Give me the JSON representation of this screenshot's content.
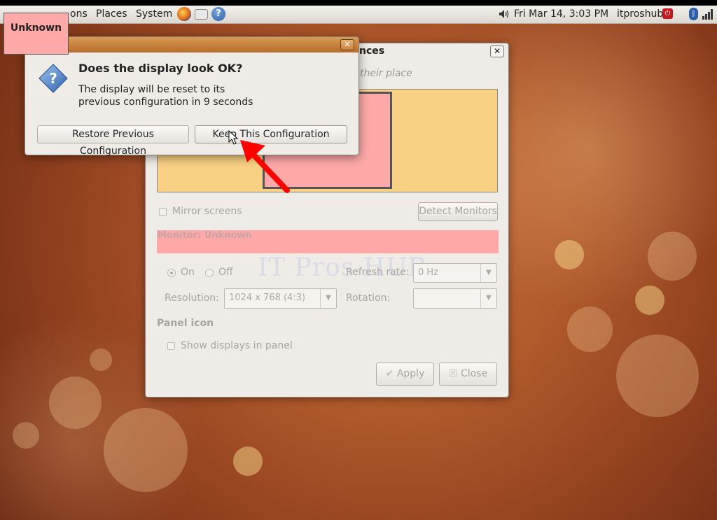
{
  "top_panel": {
    "menus": [
      "ons",
      "Places",
      "System"
    ],
    "clock": "Fri Mar 14,  3:03 PM",
    "user": "itproshub",
    "help_glyph": "?"
  },
  "unknown_label": "Unknown",
  "prefs_window": {
    "title": "nces",
    "hint": "their place",
    "mirror_label": "Mirror screens",
    "detect_button": "Detect Monitors",
    "monitor_heading": "Monitor: Unknown",
    "on_label": "On",
    "off_label": "Off",
    "refresh_label": "Refresh rate:",
    "refresh_value": "0 Hz",
    "resolution_label": "Resolution:",
    "resolution_value": "1024 x 768 (4:3)",
    "rotation_label": "Rotation:",
    "rotation_value": "",
    "panel_icon_heading": "Panel icon",
    "show_displays_label": "Show displays in panel",
    "apply_button": "Apply",
    "close_button": "Close",
    "watermark": "IT Pros HUB"
  },
  "confirm_dialog": {
    "heading": "Does the display look OK?",
    "message_line1": "The display will be reset to its",
    "message_line2": "previous configuration in 9 seconds",
    "restore_button": "Restore Previous Configuration",
    "keep_button": "Keep This Configuration"
  },
  "colors": {
    "monitor_area": "#f9d184",
    "monitor_box": "#fea8a8",
    "annotation_arrow": "#ff0000"
  },
  "icons": [
    "firefox-icon",
    "mail-icon",
    "help-icon",
    "volume-icon",
    "shutdown-icon",
    "bluetooth-icon",
    "network-icon",
    "question-icon",
    "cursor-icon"
  ]
}
